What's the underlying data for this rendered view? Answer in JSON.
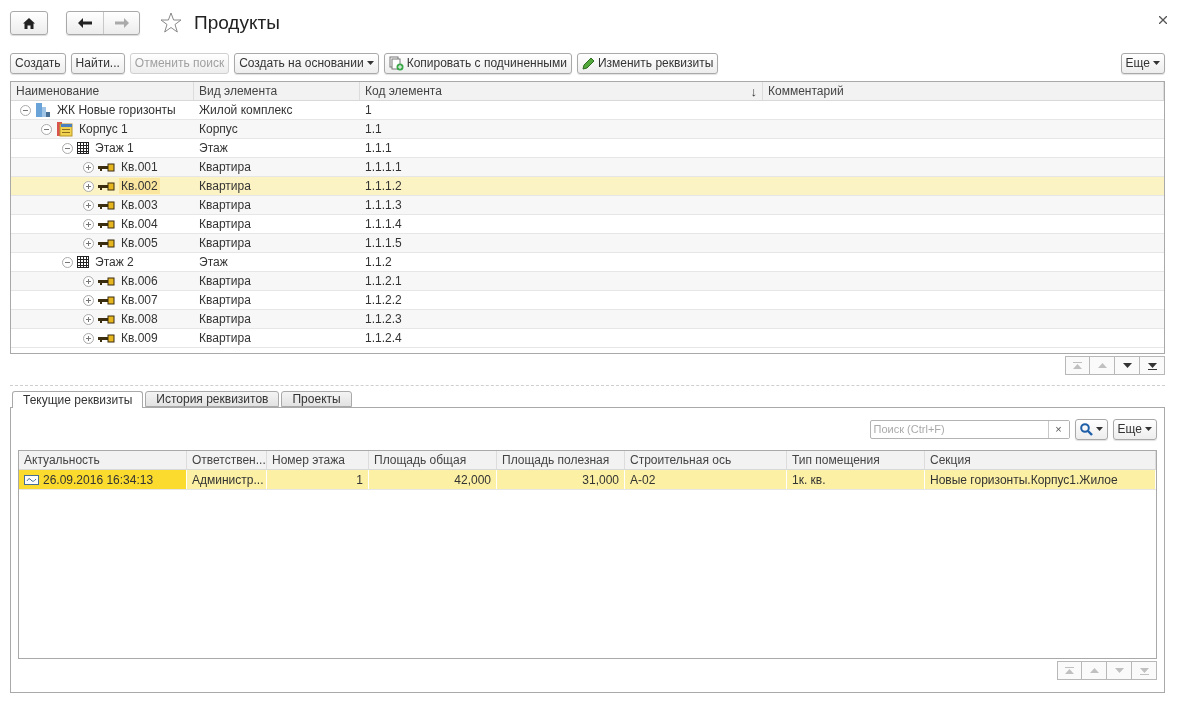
{
  "window": {
    "title": "Продукты",
    "favorite": false
  },
  "toolbar": {
    "buttons": [
      {
        "label": "Создать",
        "kind": "plain",
        "disabled": false
      },
      {
        "label": "Найти...",
        "kind": "plain",
        "disabled": false
      },
      {
        "label": "Отменить поиск",
        "kind": "plain",
        "disabled": true
      },
      {
        "label": "Создать на основании",
        "kind": "dropdown",
        "disabled": false
      },
      {
        "label": "Копировать с подчиненными",
        "kind": "copy",
        "disabled": false
      },
      {
        "label": "Изменить реквизиты",
        "kind": "edit",
        "disabled": false
      }
    ],
    "more": "Еще"
  },
  "tree": {
    "columns": [
      {
        "title": "Наименование"
      },
      {
        "title": "Вид элемента"
      },
      {
        "title": "Код элемента",
        "sort_indicator": "↓"
      },
      {
        "title": "Комментарий"
      }
    ],
    "rows": [
      {
        "name": "ЖК Новые горизонты",
        "type": "Жилой комплекс",
        "code": "1",
        "kind": "complex",
        "expanded": true,
        "selected": false,
        "children": [
          {
            "name": "Корпус 1",
            "type": "Корпус",
            "code": "1.1",
            "kind": "building",
            "expanded": true,
            "selected": false,
            "children": [
              {
                "name": "Этаж 1",
                "type": "Этаж",
                "code": "1.1.1",
                "kind": "floor",
                "expanded": true,
                "selected": false,
                "children": [
                  {
                    "name": "Кв.001",
                    "type": "Квартира",
                    "code": "1.1.1.1",
                    "kind": "apartment",
                    "expanded": false,
                    "selected": false
                  },
                  {
                    "name": "Кв.002",
                    "type": "Квартира",
                    "code": "1.1.1.2",
                    "kind": "apartment",
                    "expanded": false,
                    "selected": true
                  },
                  {
                    "name": "Кв.003",
                    "type": "Квартира",
                    "code": "1.1.1.3",
                    "kind": "apartment",
                    "expanded": false,
                    "selected": false
                  },
                  {
                    "name": "Кв.004",
                    "type": "Квартира",
                    "code": "1.1.1.4",
                    "kind": "apartment",
                    "expanded": false,
                    "selected": false
                  },
                  {
                    "name": "Кв.005",
                    "type": "Квартира",
                    "code": "1.1.1.5",
                    "kind": "apartment",
                    "expanded": false,
                    "selected": false
                  }
                ]
              },
              {
                "name": "Этаж 2",
                "type": "Этаж",
                "code": "1.1.2",
                "kind": "floor",
                "expanded": true,
                "selected": false,
                "children": [
                  {
                    "name": "Кв.006",
                    "type": "Квартира",
                    "code": "1.1.2.1",
                    "kind": "apartment",
                    "expanded": false,
                    "selected": false
                  },
                  {
                    "name": "Кв.007",
                    "type": "Квартира",
                    "code": "1.1.2.2",
                    "kind": "apartment",
                    "expanded": false,
                    "selected": false
                  },
                  {
                    "name": "Кв.008",
                    "type": "Квартира",
                    "code": "1.1.2.3",
                    "kind": "apartment",
                    "expanded": false,
                    "selected": false
                  },
                  {
                    "name": "Кв.009",
                    "type": "Квартира",
                    "code": "1.1.2.4",
                    "kind": "apartment",
                    "expanded": false,
                    "selected": false
                  }
                ]
              }
            ]
          }
        ]
      }
    ],
    "nav_buttons": [
      {
        "kind": "first",
        "disabled": true
      },
      {
        "kind": "prev",
        "disabled": true
      },
      {
        "kind": "next",
        "disabled": false
      },
      {
        "kind": "last",
        "disabled": false
      }
    ]
  },
  "tabs": [
    {
      "label": "Текущие реквизиты",
      "selected": true
    },
    {
      "label": "История реквизитов",
      "selected": false
    },
    {
      "label": "Проекты",
      "selected": false
    }
  ],
  "details": {
    "search": {
      "placeholder": "Поиск (Ctrl+F)",
      "clear": "×"
    },
    "more": "Еще",
    "columns": [
      {
        "title": "Актуальность",
        "kind": "text"
      },
      {
        "title": "Ответствен...",
        "kind": "text"
      },
      {
        "title": "Номер этажа",
        "kind": "number"
      },
      {
        "title": "Площадь общая",
        "kind": "number"
      },
      {
        "title": "Площадь полезная",
        "kind": "number"
      },
      {
        "title": "Строительная ось",
        "kind": "text"
      },
      {
        "title": "Тип помещения",
        "kind": "text"
      },
      {
        "title": "Секция",
        "kind": "text"
      }
    ],
    "rows": [
      {
        "selected": true,
        "cells": [
          "26.09.2016 16:34:13",
          "Администр...",
          "1",
          "42,000",
          "31,000",
          "А-02",
          "1к. кв.",
          "Новые горизонты.Корпус1.Жилое"
        ]
      }
    ],
    "nav_buttons": [
      {
        "kind": "first",
        "disabled": true
      },
      {
        "kind": "prev",
        "disabled": true
      },
      {
        "kind": "next",
        "disabled": true
      },
      {
        "kind": "last",
        "disabled": true
      }
    ]
  }
}
